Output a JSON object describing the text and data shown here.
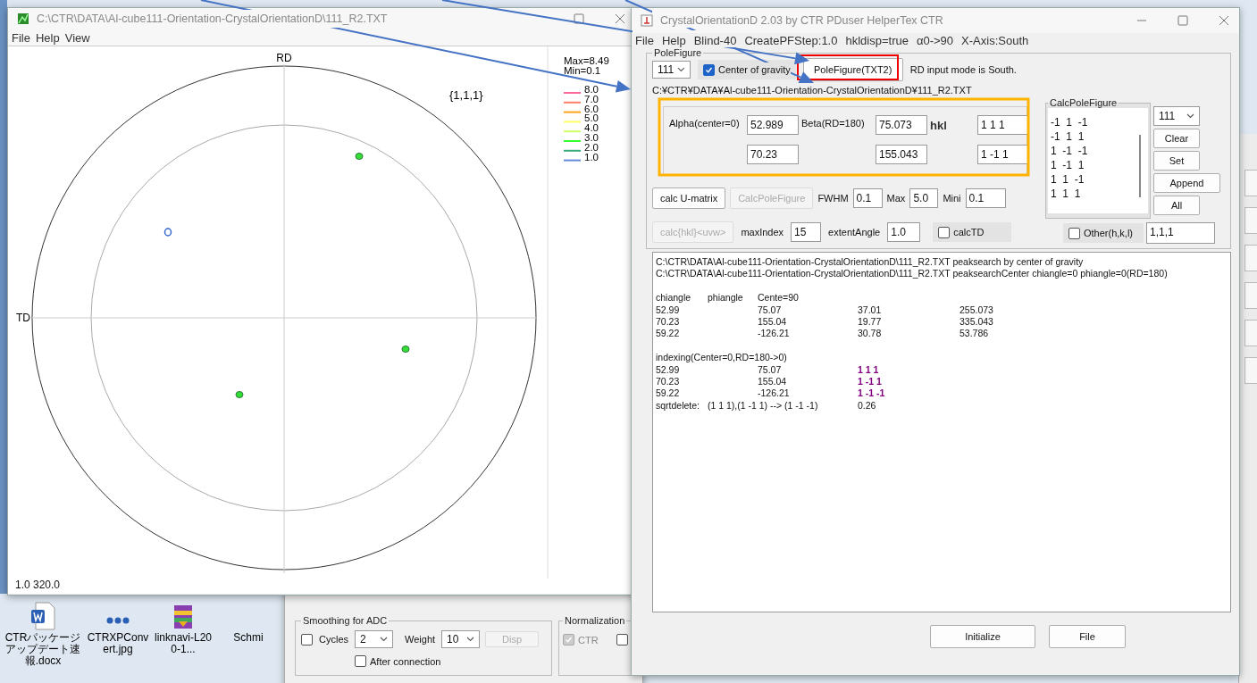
{
  "desktop": {
    "icons": [
      {
        "kind": "doc",
        "label": "CTRパッケージアップデート速報.docx"
      },
      {
        "kind": "dots",
        "label": "CTRXPConvert.jpg"
      },
      {
        "kind": "archive",
        "label": "linknavi-L200-1..."
      },
      {
        "kind": "none",
        "label": "Schmi"
      }
    ]
  },
  "plot_window": {
    "title": "C:\\CTR\\DATA\\Al-cube111-Orientation-CrystalOrientationD\\111_R2.TXT",
    "menu": [
      "File",
      "Help",
      "View"
    ],
    "rd_label": "RD",
    "td_label": "TD",
    "family": "{1,1,1}",
    "max": "Max=8.49",
    "min": "Min=0.1",
    "legend": [
      {
        "label": "8.0",
        "color": "#ff6699"
      },
      {
        "label": "7.0",
        "color": "#ff7f66"
      },
      {
        "label": "6.0",
        "color": "#ffa31a"
      },
      {
        "label": "5.0",
        "color": "#ffff66"
      },
      {
        "label": "4.0",
        "color": "#ccff66"
      },
      {
        "label": "3.0",
        "color": "#33ff33"
      },
      {
        "label": "2.0",
        "color": "#33aa77"
      },
      {
        "label": "1.0",
        "color": "#6688dd"
      }
    ],
    "status": "1.0 320.0"
  },
  "background_window": {
    "smoothing": {
      "title": "Smoothing for ADC",
      "cycles": {
        "label": "Cycles",
        "checked": false
      },
      "cycles_value": "2",
      "weight_label": "Weight",
      "weight_value": "10",
      "disp_button": "Disp",
      "after_connection": {
        "label": "After connection",
        "checked": false
      }
    },
    "normalization": {
      "title": "Normalization",
      "checkboxes": [
        {
          "label": "CTR",
          "checked": true,
          "disabled": true
        },
        {
          "checked": false,
          "disabled": false
        }
      ]
    }
  },
  "main_window": {
    "title": "CrystalOrientationD 2.03 by CTR PDuser HelperTex CTR",
    "menu": [
      "File",
      "Help",
      "Blind-40",
      "CreatePFStep:1.0",
      "hkldisp=true",
      "α0->90",
      "X-Axis:South"
    ],
    "pole_figure": {
      "title": "PoleFigure",
      "hkl_select": "111",
      "center_of_gravity": {
        "label": "Center of gravity",
        "checked": true
      },
      "button": "PoleFigure(TXT2)",
      "mode_text": "RD input mode is South.",
      "path": "C:¥CTR¥DATA¥Al-cube111-Orientation-CrystalOrientationD¥111_R2.TXT",
      "alpha_label": "Alpha(center=0)",
      "beta_label": "Beta(RD=180)",
      "hkl_label": "hkl",
      "angles": [
        {
          "alpha": "52.989",
          "beta": "75.073",
          "hkl": "1 1 1"
        },
        {
          "alpha": "70.23",
          "beta": "155.043",
          "hkl": "1 -1 1"
        }
      ],
      "calc_umatrix": {
        "label": "calc U-matrix",
        "disabled": false
      },
      "calc_pole_figure": {
        "label": "CalcPoleFigure",
        "disabled": true
      },
      "fwhm_label": "FWHM",
      "fwhm": "0.1",
      "max_label": "Max",
      "max": "5.0",
      "mini_label": "Mini",
      "mini": "0.1",
      "calc_hkl_uvw": {
        "label": "calc{hkl}<uvw>",
        "disabled": true
      },
      "max_index_label": "maxIndex",
      "max_index": "15",
      "extent_angle_label": "extentAngle",
      "extent_angle": "1.0",
      "calc_td": {
        "label": "calcTD",
        "checked": false
      },
      "list": {
        "title": "CalcPoleFigure",
        "items": [
          "-1  1  -1",
          "-1  1  1",
          "1  -1  -1",
          "1  -1  1",
          "1  1  -1",
          "1  1  1"
        ]
      },
      "list_select": "111",
      "side_buttons": [
        "Clear",
        "Set",
        "Append",
        "All"
      ],
      "other": {
        "label": "Other(h,k,l)",
        "checked": false
      },
      "other_value": "1,1,1"
    },
    "log": [
      {
        "kind": "text",
        "text": "C:\\CTR\\DATA\\Al-cube111-Orientation-CrystalOrientationD\\111_R2.TXT peaksearch by center of gravity"
      },
      {
        "kind": "text",
        "text": "C:\\CTR\\DATA\\Al-cube111-Orientation-CrystalOrientationD\\111_R2.TXT peaksearchCenter chiangle=0 phiangle=0(RD=180)"
      },
      {
        "kind": "blank"
      },
      {
        "kind": "cells",
        "column_1": "chiangle",
        "column_2": "phiangle",
        "column_3": "Cente=90"
      },
      {
        "kind": "cells",
        "column_1": "52.99",
        "column_3": "75.07",
        "column_4": "37.01",
        "column_5": "255.073"
      },
      {
        "kind": "cells",
        "column_1": "70.23",
        "column_3": "155.04",
        "column_4": "19.77",
        "column_5": "335.043"
      },
      {
        "kind": "cells",
        "column_1": "59.22",
        "column_3": "-126.21",
        "column_4": "30.78",
        "column_5": "53.786"
      },
      {
        "kind": "blank"
      },
      {
        "kind": "text",
        "text": "indexing(Center=0,RD=180->0)"
      },
      {
        "kind": "cells",
        "column_1": "52.99",
        "column_3": "75.07",
        "column_4": {
          "text": "1 1 1",
          "color": "#800080"
        }
      },
      {
        "kind": "cells",
        "column_1": "70.23",
        "column_3": "155.04",
        "column_4": {
          "text": "1 -1 1",
          "color": "#800080"
        }
      },
      {
        "kind": "cells",
        "column_1": "59.22",
        "column_3": "-126.21",
        "column_4": {
          "text": "1 -1 -1",
          "color": "#800080"
        }
      },
      {
        "kind": "cells",
        "column_1": "sqrtdelete:",
        "column_2": "(1 1 1),(1 -1 1) -->  (1 -1 -1)",
        "column_4": "0.26"
      }
    ],
    "buttons": [
      "Initialize",
      "File"
    ]
  }
}
